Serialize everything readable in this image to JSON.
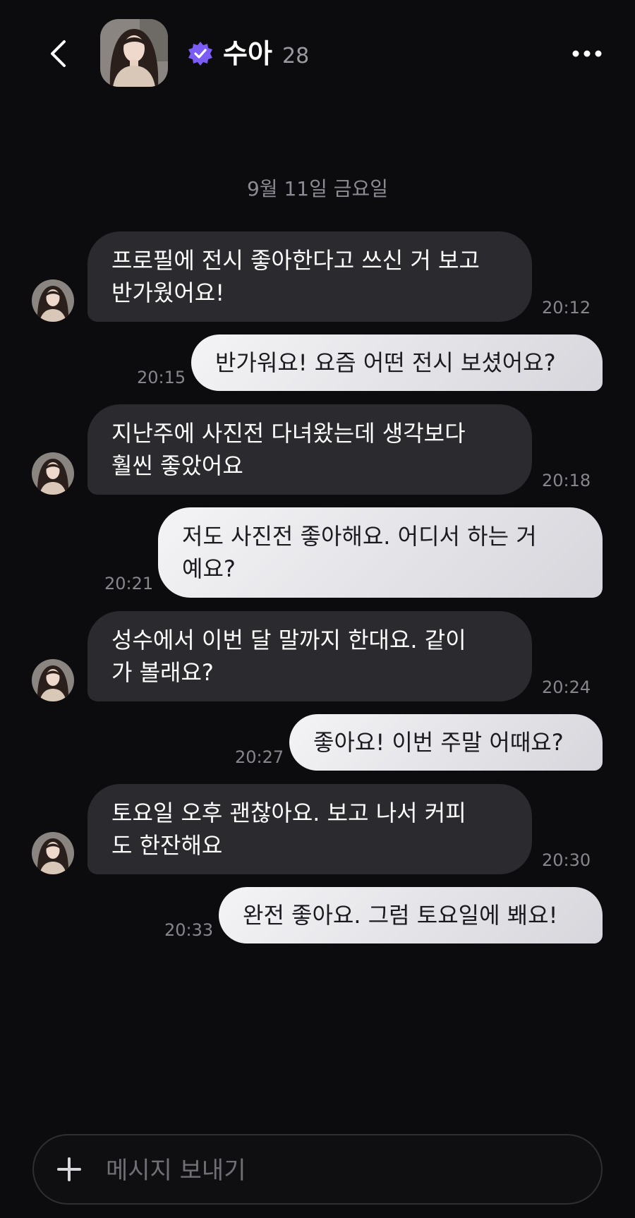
{
  "header": {
    "back_icon": "chevron-left-icon",
    "name": "수아",
    "age": "28",
    "verified_icon": "verified-badge-icon",
    "verified_color": "#7b5cf5",
    "more_icon": "more-horizontal-icon"
  },
  "date_separator": "9월 11일 금요일",
  "messages": [
    {
      "direction": "in",
      "text": "프로필에 전시 좋아한다고 쓰신 거 보고\n반가웠어요!",
      "time": "20:12"
    },
    {
      "direction": "out",
      "text": "반가워요! 요즘 어떤 전시 보셨어요?",
      "time": "20:15"
    },
    {
      "direction": "in",
      "text": "지난주에 사진전 다녀왔는데 생각보다\n훨씬 좋았어요",
      "time": "20:18"
    },
    {
      "direction": "out",
      "text": "저도 사진전 좋아해요. 어디서 하는 거\n예요?",
      "time": "20:21"
    },
    {
      "direction": "in",
      "text": "성수에서 이번 달 말까지 한대요. 같이\n가 볼래요?",
      "time": "20:24"
    },
    {
      "direction": "out",
      "text": "좋아요! 이번 주말 어때요?",
      "time": "20:27"
    },
    {
      "direction": "in",
      "text": "토요일 오후 괜찮아요. 보고 나서 커피\n도 한잔해요",
      "time": "20:30"
    },
    {
      "direction": "out",
      "text": "완전 좋아요. 그럼 토요일에 봬요!",
      "time": "20:33"
    }
  ],
  "composer": {
    "plus_icon": "plus-icon",
    "placeholder": "메시지 보내기"
  },
  "colors": {
    "background": "#0c0c0e",
    "incoming_bubble": "#2a2a2f",
    "outgoing_bubble": "#e6e6ea"
  }
}
